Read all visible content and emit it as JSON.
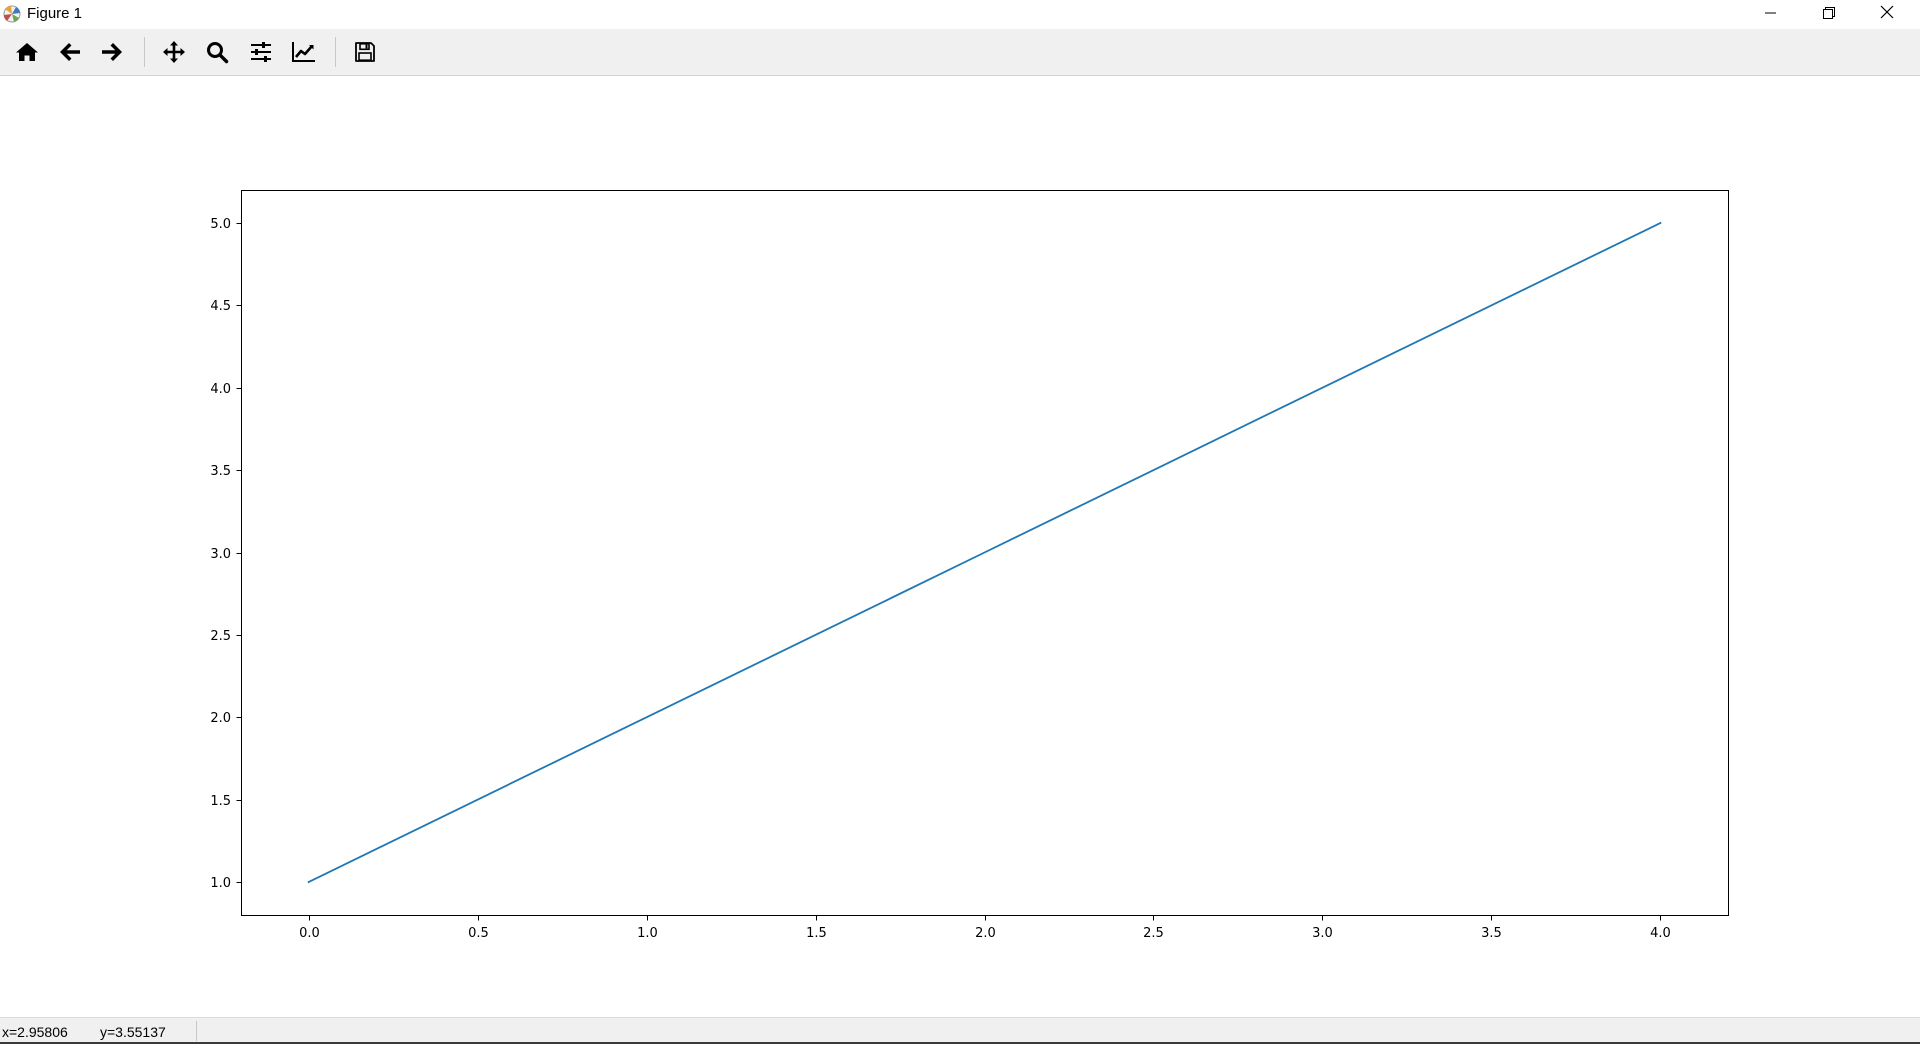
{
  "window": {
    "title": "Figure 1",
    "app_icon": "matplotlib-icon",
    "controls": {
      "minimize": "minimize-icon",
      "maximize": "restore-icon",
      "close": "close-icon"
    }
  },
  "toolbar": {
    "buttons": [
      {
        "name": "home",
        "icon": "home-icon",
        "tooltip": "Reset original view"
      },
      {
        "name": "back",
        "icon": "arrow-left-icon",
        "tooltip": "Back to previous view"
      },
      {
        "name": "forward",
        "icon": "arrow-right-icon",
        "tooltip": "Forward to next view"
      },
      {
        "name": "pan",
        "icon": "move-icon",
        "tooltip": "Pan axes"
      },
      {
        "name": "zoom",
        "icon": "magnifier-icon",
        "tooltip": "Zoom to rectangle"
      },
      {
        "name": "subplots",
        "icon": "sliders-icon",
        "tooltip": "Configure subplots"
      },
      {
        "name": "customize",
        "icon": "line-chart-icon",
        "tooltip": "Edit axis, curve and image parameters"
      },
      {
        "name": "save",
        "icon": "floppy-disk-icon",
        "tooltip": "Save the figure"
      }
    ]
  },
  "status": {
    "x": "x=2.95806",
    "y": "y=3.55137"
  },
  "chart_data": {
    "type": "line",
    "title": "",
    "xlabel": "",
    "ylabel": "",
    "xlim": [
      -0.2,
      4.2
    ],
    "ylim": [
      0.8,
      5.2
    ],
    "xticks": [
      "0.0",
      "0.5",
      "1.0",
      "1.5",
      "2.0",
      "2.5",
      "3.0",
      "3.5",
      "4.0"
    ],
    "yticks": [
      "1.0",
      "1.5",
      "2.0",
      "2.5",
      "3.0",
      "3.5",
      "4.0",
      "4.5",
      "5.0"
    ],
    "grid": false,
    "series": [
      {
        "x": [
          0,
          1,
          2,
          3,
          4
        ],
        "y": [
          1,
          2,
          3,
          4,
          5
        ],
        "color": "#1f77b4"
      }
    ]
  }
}
